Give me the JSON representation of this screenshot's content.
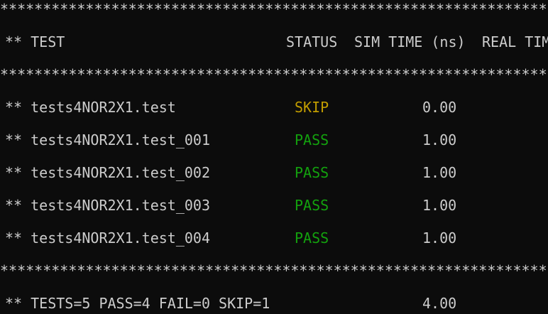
{
  "separator": "**************************************************************************************************************",
  "header": {
    "test": "** TEST",
    "status": "STATUS",
    "sim_time": "SIM TIME (ns)",
    "real_time": "REAL TIME (s)"
  },
  "rows": [
    {
      "name": "** tests4NOR2X1.test",
      "status": "SKIP",
      "sim_time": "0.00"
    },
    {
      "name": "** tests4NOR2X1.test_001",
      "status": "PASS",
      "sim_time": "1.00"
    },
    {
      "name": "** tests4NOR2X1.test_002",
      "status": "PASS",
      "sim_time": "1.00"
    },
    {
      "name": "** tests4NOR2X1.test_003",
      "status": "PASS",
      "sim_time": "1.00"
    },
    {
      "name": "** tests4NOR2X1.test_004",
      "status": "PASS",
      "sim_time": "1.00"
    }
  ],
  "summary": {
    "text": "** TESTS=5 PASS=4 FAIL=0 SKIP=1",
    "sim_time": "4.00"
  },
  "colors": {
    "background": "#0c0c0c",
    "text": "#cccccc",
    "skip": "#c19c00",
    "pass": "#13a10e"
  }
}
